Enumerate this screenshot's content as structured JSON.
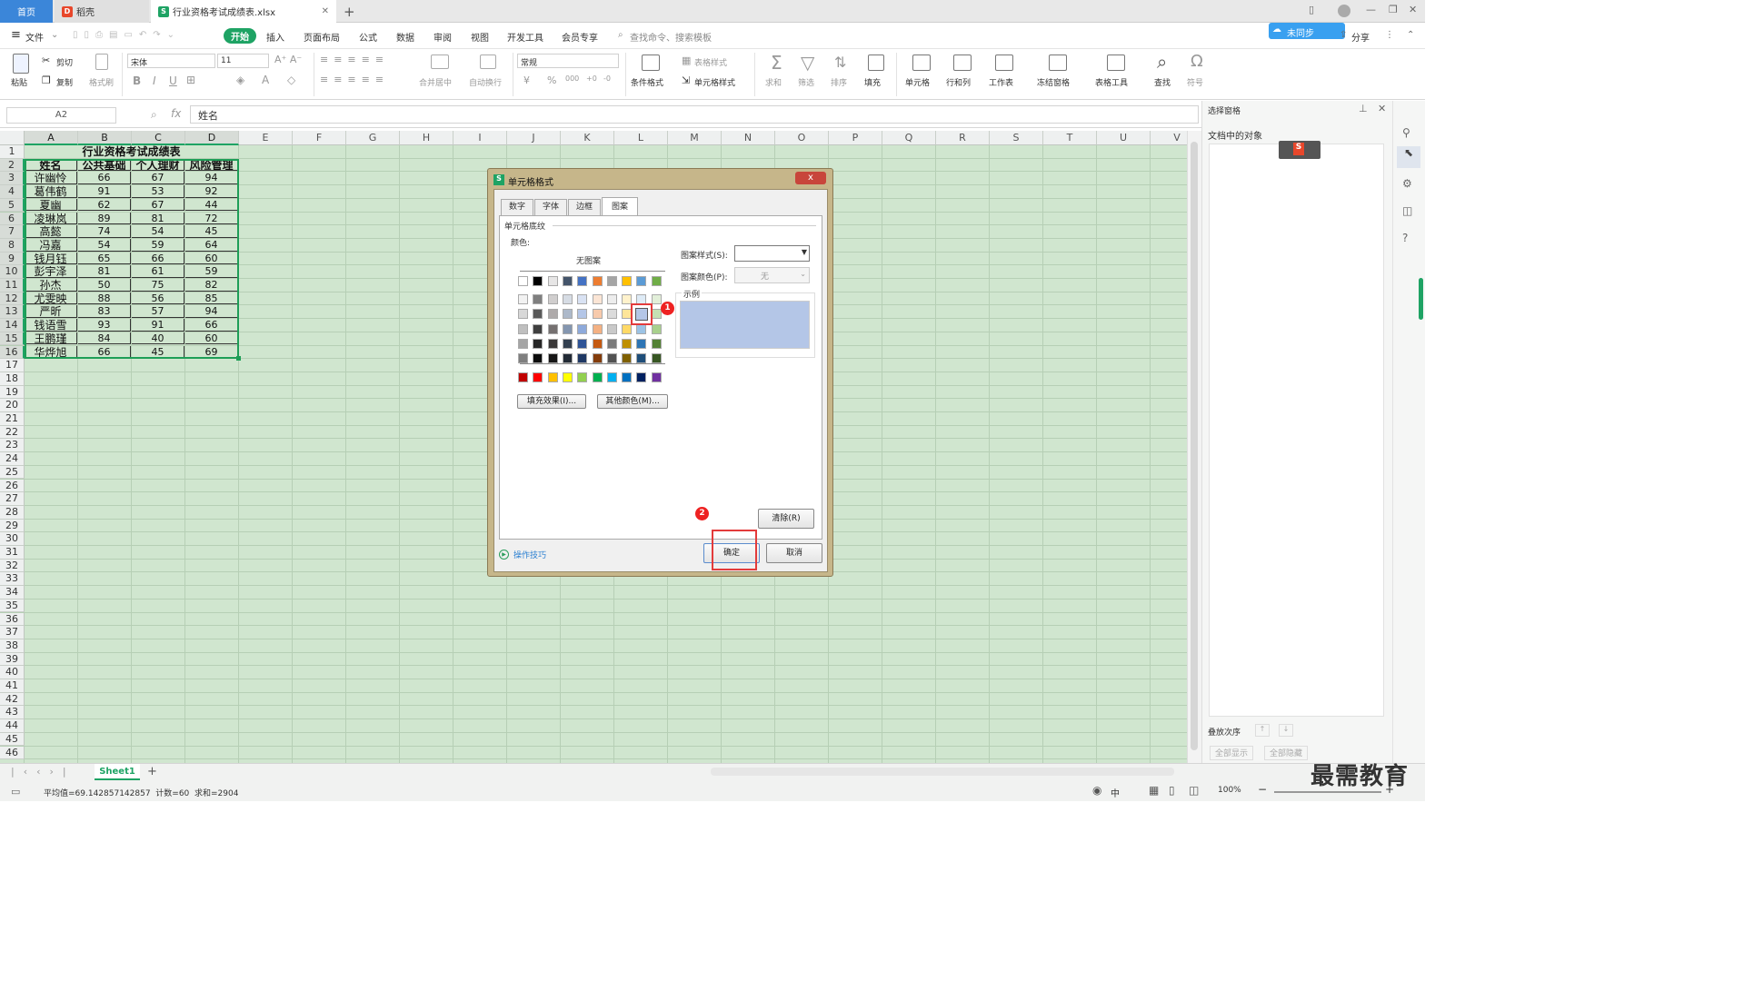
{
  "tabs": {
    "home": "首页",
    "shell": "稻壳",
    "file": "行业资格考试成绩表.xlsx",
    "add": "+"
  },
  "menu": {
    "file": "文件",
    "items": [
      "开始",
      "插入",
      "页面布局",
      "公式",
      "数据",
      "审阅",
      "视图",
      "开发工具",
      "会员专享"
    ],
    "search": "查找命令、搜索模板",
    "share": "分享",
    "sync": "未同步"
  },
  "ribbon": {
    "paste": "粘贴",
    "cut": "剪切",
    "copy": "复制",
    "format_painter": "格式刷",
    "font_name": "宋体",
    "font_size": "11",
    "bold": "B",
    "italic": "I",
    "underline": "U",
    "merge": "合并居中",
    "wrap": "自动换行",
    "number_format": "常规",
    "cond_format": "条件格式",
    "table_style": "表格样式",
    "cell_style": "单元格样式",
    "sum": "求和",
    "filter": "筛选",
    "sort": "排序",
    "fill": "填充",
    "cell": "单元格",
    "rowcol": "行和列",
    "worksheet": "工作表",
    "freeze": "冻结窗格",
    "table_tools": "表格工具",
    "find": "查找",
    "symbol": "符号",
    "yen": "¥",
    "percent": "%",
    "thousands": "000",
    "dec_inc": "+0",
    "dec_dec": "-0"
  },
  "formula": {
    "name_box": "A2",
    "fx": "fx",
    "content": "姓名"
  },
  "sheet": {
    "columns": [
      "A",
      "B",
      "C",
      "D",
      "E",
      "F",
      "G",
      "H",
      "I",
      "J",
      "K",
      "L",
      "M",
      "N",
      "O",
      "P",
      "Q",
      "R",
      "S",
      "T",
      "U",
      "V"
    ],
    "rows": [
      "1",
      "2",
      "3",
      "4",
      "5",
      "6",
      "7",
      "8",
      "9",
      "10",
      "11",
      "12",
      "13",
      "14",
      "15",
      "16",
      "17",
      "18",
      "19",
      "20",
      "21",
      "22",
      "23",
      "24",
      "25",
      "26",
      "27",
      "28",
      "29",
      "30",
      "31",
      "32",
      "33",
      "34",
      "35",
      "36",
      "37",
      "38",
      "39",
      "40",
      "41",
      "42",
      "43",
      "44",
      "45",
      "46"
    ],
    "title": "行业资格考试成绩表",
    "headers": [
      "姓名",
      "公共基础",
      "个人理财",
      "风险管理"
    ],
    "data": [
      [
        "许幽怜",
        "66",
        "67",
        "94"
      ],
      [
        "葛伟鹤",
        "91",
        "53",
        "92"
      ],
      [
        "夏幽",
        "62",
        "67",
        "44"
      ],
      [
        "凌琳岚",
        "89",
        "81",
        "72"
      ],
      [
        "高懿",
        "74",
        "54",
        "45"
      ],
      [
        "冯嘉",
        "54",
        "59",
        "64"
      ],
      [
        "钱月钰",
        "65",
        "66",
        "60"
      ],
      [
        "彭宇泽",
        "81",
        "61",
        "59"
      ],
      [
        "孙杰",
        "50",
        "75",
        "82"
      ],
      [
        "尤雯映",
        "88",
        "56",
        "85"
      ],
      [
        "严昕",
        "83",
        "57",
        "94"
      ],
      [
        "钱语雪",
        "93",
        "91",
        "66"
      ],
      [
        "王鹏瑾",
        "84",
        "40",
        "60"
      ],
      [
        "华烨旭",
        "66",
        "45",
        "69"
      ]
    ]
  },
  "sheet_tabs": {
    "active": "Sheet1",
    "add": "+"
  },
  "status": {
    "summary": "平均值=69.142857142857  计数=60  求和=2904",
    "zoom": "100%",
    "cn": "中"
  },
  "panel": {
    "title": "选择窗格",
    "objects": "文档中的对象",
    "order": "叠放次序",
    "show_all": "全部显示",
    "hide_all": "全部隐藏",
    "app_label": "S"
  },
  "dialog": {
    "title": "单元格格式",
    "close": "x",
    "tabs": [
      "数字",
      "字体",
      "边框",
      "图案"
    ],
    "group": "单元格底纹",
    "color_label": "颜色:",
    "no_pattern": "无图案",
    "pattern_style": "图案样式(S):",
    "pattern_color": "图案颜色(P):",
    "pattern_color_value": "无",
    "sample": "示例",
    "fill_effects": "填充效果(I)...",
    "other_colors": "其他颜色(M)...",
    "clear": "清除(R)",
    "tips": "操作技巧",
    "ok": "确定",
    "cancel": "取消",
    "badge1": "1",
    "badge2": "2",
    "selected_color": "#b4c6e7",
    "palette_top": [
      "#ffffff",
      "#000000",
      "#e7e6e6",
      "#44546a",
      "#4472c4",
      "#ed7d31",
      "#a5a5a5",
      "#ffc000",
      "#5b9bd5",
      "#70ad47"
    ],
    "palette": [
      [
        "#f2f2f2",
        "#7f7f7f",
        "#d0cece",
        "#d6dce4",
        "#d9e2f3",
        "#fbe5d5",
        "#ededed",
        "#fff2cc",
        "#deebf6",
        "#e2efd9"
      ],
      [
        "#d8d8d8",
        "#595959",
        "#aeaaaa",
        "#adb9ca",
        "#b4c6e7",
        "#f7caac",
        "#dbdbdb",
        "#fee599",
        "#bdd7ee",
        "#c5e0b3"
      ],
      [
        "#bfbfbf",
        "#3f3f3f",
        "#757070",
        "#8496b0",
        "#8eaadb",
        "#f4b183",
        "#c9c9c9",
        "#ffd966",
        "#9cc3e5",
        "#a8d08d"
      ],
      [
        "#a5a5a5",
        "#262626",
        "#3a3838",
        "#323f4f",
        "#2f5496",
        "#c55a11",
        "#7b7b7b",
        "#bf9000",
        "#2e75b5",
        "#538135"
      ],
      [
        "#7f7f7f",
        "#0c0c0c",
        "#171616",
        "#222a35",
        "#1f3864",
        "#833c0b",
        "#525252",
        "#7f6000",
        "#1f4e79",
        "#375623"
      ]
    ],
    "palette_std": [
      "#c00000",
      "#ff0000",
      "#ffc000",
      "#ffff00",
      "#92d050",
      "#00b050",
      "#00b0f0",
      "#0070c0",
      "#002060",
      "#7030a0"
    ]
  },
  "watermark": "最需教育"
}
